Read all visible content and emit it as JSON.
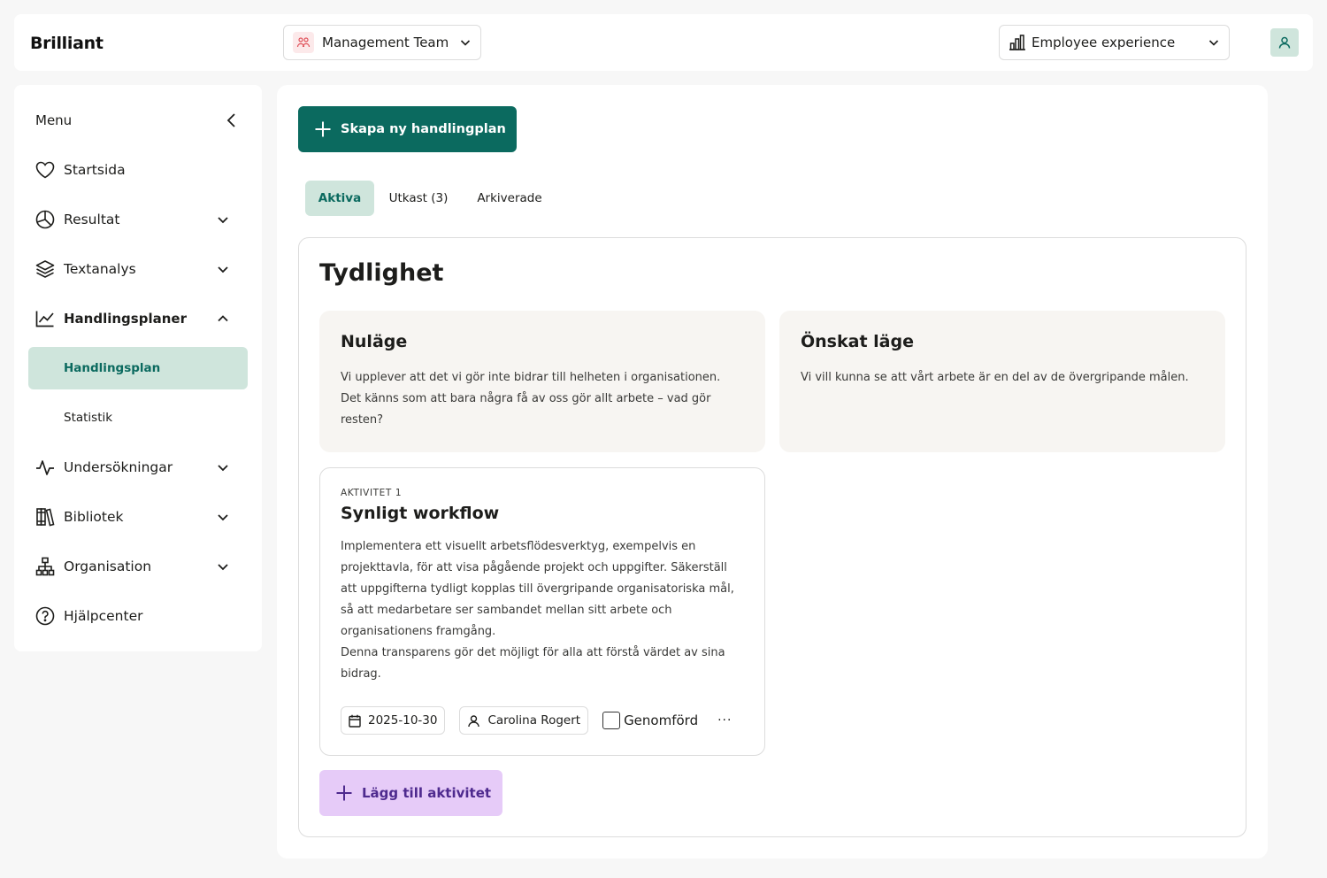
{
  "header": {
    "logo": "Brilliant",
    "team_select": "Management Team",
    "experience_select": "Employee experience"
  },
  "sidebar": {
    "menu_label": "Menu",
    "items": [
      {
        "label": "Startsida",
        "icon": "heart-icon"
      },
      {
        "label": "Resultat",
        "icon": "pie-chart-icon"
      },
      {
        "label": "Textanalys",
        "icon": "layers-icon"
      },
      {
        "label": "Handlingsplaner",
        "icon": "trend-chart-icon"
      },
      {
        "label": "Undersökningar",
        "icon": "activity-icon"
      },
      {
        "label": "Bibliotek",
        "icon": "books-icon"
      },
      {
        "label": "Organisation",
        "icon": "org-chart-icon"
      },
      {
        "label": "Hjälpcenter",
        "icon": "help-circle-icon"
      }
    ],
    "sub_items": [
      {
        "label": "Handlingsplan"
      },
      {
        "label": "Statistik"
      }
    ]
  },
  "main": {
    "create_button": "Skapa ny handlingplan",
    "tabs": [
      {
        "label": "Aktiva"
      },
      {
        "label": "Utkast (3)"
      },
      {
        "label": "Arkiverade"
      }
    ],
    "plan": {
      "title": "Tydlighet",
      "current": {
        "title": "Nuläge",
        "text": "Vi upplever att det vi gör inte bidrar till helheten i organisationen. Det känns som att bara några få av oss gör allt arbete – vad gör resten?"
      },
      "desired": {
        "title": "Önskat läge",
        "text": "Vi vill kunna se att vårt arbete är en del av de övergripande målen."
      },
      "activity": {
        "kicker": "AKTIVITET 1",
        "title": "Synligt workflow",
        "text1": "Implementera ett visuellt arbetsflödesverktyg, exempelvis en projekttavla, för att visa pågående projekt och uppgifter. Säkerställ att uppgifterna tydligt kopplas till övergripande organisatoriska mål, så att medarbetare ser sambandet mellan sitt arbete och organisationens framgång.",
        "text2": "Denna transparens gör det möjligt för alla att förstå värdet av sina bidrag.",
        "date": "2025-10-30",
        "assignee": "Carolina Rogert",
        "done_label": "Genomförd",
        "more": "···"
      },
      "add_button": "Lägg till aktivitet"
    }
  },
  "colors": {
    "primary": "#0b6a5f",
    "primary_light": "#cfe5dc",
    "add_button_bg": "#e6cbf8",
    "add_button_text": "#4e2a8e",
    "state_box_bg": "#f7f5f2"
  }
}
